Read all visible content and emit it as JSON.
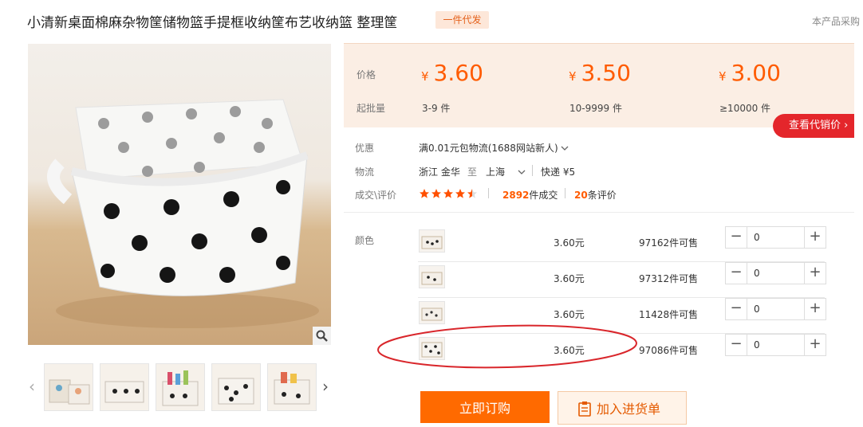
{
  "title": "小清新桌面棉麻杂物筐储物篮手提框收纳筐布艺收纳篮 整理筐",
  "badge": "一件代发",
  "right_note": "本产品采购",
  "price_panel": {
    "price_label": "价格",
    "moq_label": "起批量",
    "currency": "¥",
    "tiers": [
      {
        "price": "3.60",
        "range": "3-9 件"
      },
      {
        "price": "3.50",
        "range": "10-9999 件"
      },
      {
        "price": "3.00",
        "range": "≥10000 件"
      }
    ],
    "agent_button": "查看代销价 ›"
  },
  "info": {
    "promo_label": "优惠",
    "promo_value": "满0.01元包物流(1688网站新人)",
    "logistics_label": "物流",
    "origin": "浙江 金华",
    "to": "至",
    "destination": "上海",
    "express": "快递 ¥5",
    "deal_label": "成交\\评价",
    "rating": 4.5,
    "deals_count": "2892",
    "deals_suffix": "件成交",
    "reviews_count": "20",
    "reviews_suffix": "条评价"
  },
  "sku": {
    "color_label": "颜色",
    "rows": [
      {
        "price": "3.60元",
        "stock": "97162件可售",
        "qty": "0"
      },
      {
        "price": "3.60元",
        "stock": "97312件可售",
        "qty": "0"
      },
      {
        "price": "3.60元",
        "stock": "11428件可售",
        "qty": "0"
      },
      {
        "price": "3.60元",
        "stock": "97086件可售",
        "qty": "0"
      }
    ],
    "minus": "−",
    "plus": "+"
  },
  "actions": {
    "buy_now": "立即订购",
    "add_cart": "加入进货单"
  },
  "colors": {
    "accent_orange": "#ff5b00",
    "agent_red": "#e4262b",
    "annotation_red": "#d9262b"
  }
}
